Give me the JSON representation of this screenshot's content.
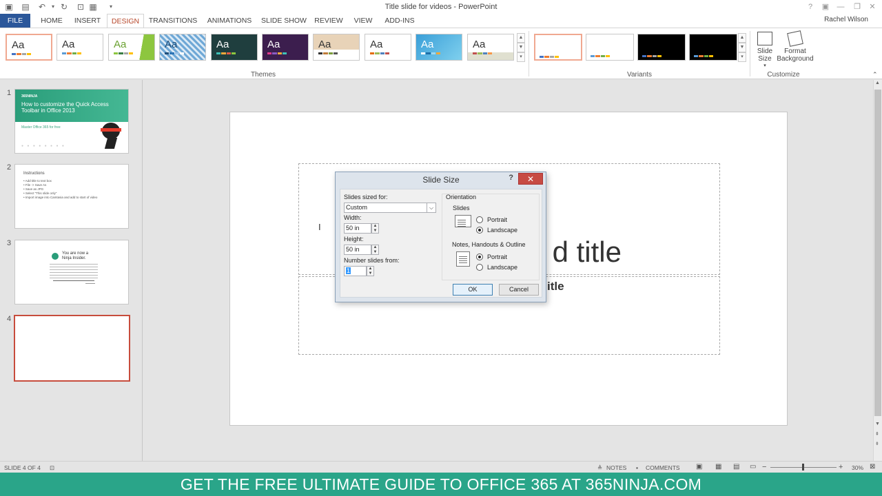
{
  "window": {
    "title": "Title slide for videos - PowerPoint",
    "help_glyph": "?",
    "user": "Rachel Wilson"
  },
  "tabs": [
    {
      "label": "FILE"
    },
    {
      "label": "HOME"
    },
    {
      "label": "INSERT"
    },
    {
      "label": "DESIGN"
    },
    {
      "label": "TRANSITIONS"
    },
    {
      "label": "ANIMATIONS"
    },
    {
      "label": "SLIDE SHOW"
    },
    {
      "label": "REVIEW"
    },
    {
      "label": "VIEW"
    },
    {
      "label": "ADD-INS"
    }
  ],
  "ribbon": {
    "themes_label": "Themes",
    "variants_label": "Variants",
    "customize_label": "Customize",
    "slide_size_label": "Slide Size",
    "format_background_label_1": "Format",
    "format_background_label_2": "Background",
    "theme_glyph": "Aa"
  },
  "slides": [
    {
      "number": "1",
      "title": "How to customize the Quick Access Toolbar in Office 2013",
      "brand": "365NINJA",
      "tagline": "Master Office 365 for free"
    },
    {
      "number": "2",
      "heading": "Instructions",
      "lines": [
        "• Add title to text box",
        "• File -> Save As",
        "• Save as JPG",
        "• Select \"This slide only\"",
        "• Import image into Camtasia and add to start of video"
      ]
    },
    {
      "number": "3",
      "lines": [
        "You are now a",
        "Ninja Insider."
      ]
    },
    {
      "number": "4"
    }
  ],
  "slide_canvas": {
    "title_visible": "d title",
    "subtitle_visible": "itle"
  },
  "dialog": {
    "title": "Slide Size",
    "help": "?",
    "close": "✕",
    "slides_sized_for_label": "Slides sized for:",
    "slides_sized_for_value": "Custom",
    "width_label": "Width:",
    "width_value": "50 in",
    "height_label": "Height:",
    "height_value": "50 in",
    "number_from_label": "Number slides from:",
    "number_from_value": "1",
    "orientation_label": "Orientation",
    "slides_group_label": "Slides",
    "portrait_label": "Portrait",
    "landscape_label": "Landscape",
    "notes_group_label": "Notes, Handouts & Outline",
    "ok_label": "OK",
    "cancel_label": "Cancel"
  },
  "status": {
    "slide_indicator": "SLIDE 4 OF 4",
    "notes_label": "NOTES",
    "comments_label": "COMMENTS",
    "zoom": "30%"
  },
  "banner": {
    "text": "GET THE FREE ULTIMATE GUIDE TO OFFICE 365 AT 365NINJA.COM"
  },
  "colors": {
    "file_tab": "#2b579a",
    "accent": "#b7472a",
    "banner": "#2aa589",
    "selected_slide": "#c74c3c",
    "close_button": "#c74b43"
  }
}
